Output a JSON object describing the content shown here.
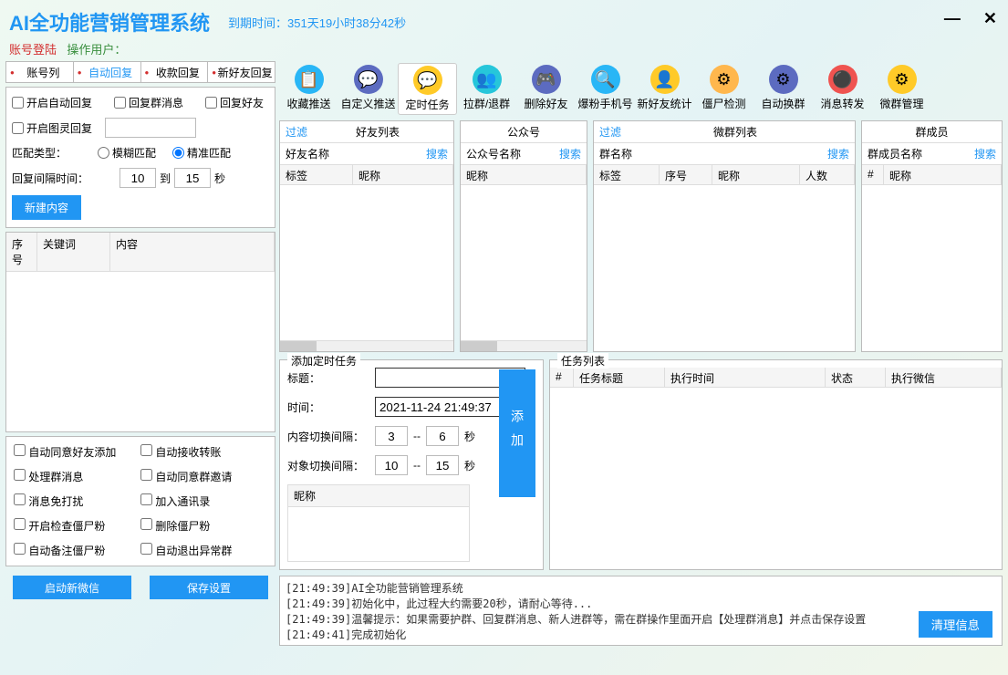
{
  "header": {
    "title": "AI全功能营销管理系统",
    "expiry_label": "到期时间：",
    "expiry_value": "351天19小时38分42秒"
  },
  "subheader": {
    "login_label": "账号登陆",
    "user_label": "操作用户："
  },
  "tabs": [
    "账号列",
    "自动回复",
    "收款回复",
    "新好友回复"
  ],
  "active_tab": 1,
  "reply": {
    "auto_reply": "开启自动回复",
    "reply_group": "回复群消息",
    "reply_friend": "回复好友",
    "pic_reply": "开启图灵回复",
    "match_type": "匹配类型：",
    "fuzzy": "模糊匹配",
    "exact": "精准匹配",
    "interval_label": "回复间隔时间：",
    "from": "10",
    "to_word": "到",
    "to": "15",
    "second": "秒",
    "new_content": "新建内容"
  },
  "reply_table": {
    "cols": [
      "序号",
      "关键词",
      "内容"
    ]
  },
  "options": {
    "auto_accept": "自动同意好友添加",
    "auto_transfer": "自动接收转账",
    "process_group": "处理群消息",
    "auto_group_invite": "自动同意群邀请",
    "no_disturb": "消息免打扰",
    "add_contacts": "加入通讯录",
    "check_zombie": "开启检查僵尸粉",
    "del_zombie": "删除僵尸粉",
    "auto_note_zombie": "自动备注僵尸粉",
    "auto_exit_group": "自动退出异常群"
  },
  "bottom_buttons": {
    "start": "启动新微信",
    "save": "保存设置"
  },
  "toolbar": [
    {
      "label": "收藏推送",
      "icon": "📋",
      "bg": "#29b6f6"
    },
    {
      "label": "自定义推送",
      "icon": "💬",
      "bg": "#5c6bc0"
    },
    {
      "label": "定时任务",
      "icon": "💬",
      "bg": "#ffca28",
      "active": true
    },
    {
      "label": "拉群/退群",
      "icon": "👥",
      "bg": "#26c6da"
    },
    {
      "label": "删除好友",
      "icon": "🎮",
      "bg": "#5c6bc0"
    },
    {
      "label": "爆粉手机号",
      "icon": "🔍",
      "bg": "#29b6f6"
    },
    {
      "label": "新好友统计",
      "icon": "👤",
      "bg": "#ffca28"
    },
    {
      "label": "僵尸检测",
      "icon": "⚙",
      "bg": "#ffb74d"
    },
    {
      "label": "自动换群",
      "icon": "⚙",
      "bg": "#5c6bc0"
    },
    {
      "label": "消息转发",
      "icon": "⚫",
      "bg": "#ef5350"
    },
    {
      "label": "微群管理",
      "icon": "⚙",
      "bg": "#ffca28"
    }
  ],
  "friend_panel": {
    "filter": "过滤",
    "title": "好友列表",
    "search_label": "好友名称",
    "search": "搜索",
    "cols": [
      "标签",
      "昵称"
    ]
  },
  "public_panel": {
    "title": "公众号",
    "search_label": "公众号名称",
    "search": "搜索",
    "cols": [
      "昵称"
    ]
  },
  "group_panel": {
    "filter": "过滤",
    "title": "微群列表",
    "search_label": "群名称",
    "search": "搜索",
    "cols": [
      "标签",
      "序号",
      "昵称",
      "人数"
    ]
  },
  "member_panel": {
    "title": "群成员",
    "search_label": "群成员名称",
    "search": "搜索",
    "cols": [
      "#",
      "昵称"
    ]
  },
  "add_task": {
    "title": "添加定时任务",
    "topic": "标题：",
    "time": "时间：",
    "time_value": "2021-11-24 21:49:37",
    "content_interval": "内容切换间隔：",
    "content_from": "3",
    "content_to": "6",
    "target_interval": "对象切换间隔：",
    "target_from": "10",
    "target_to": "15",
    "dash": "--",
    "second": "秒",
    "nick": "昵称",
    "add": "添加"
  },
  "task_list": {
    "title": "任务列表",
    "cols": [
      "#",
      "任务标题",
      "执行时间",
      "状态",
      "执行微信"
    ]
  },
  "log": {
    "lines": [
      "[21:49:39]AI全功能营销管理系统",
      "[21:49:39]初始化中，此过程大约需要20秒，请耐心等待...",
      "[21:49:39]温馨提示：如果需要护群、回复群消息、新人进群等，需在群操作里面开启【处理群消息】并点击保存设置",
      "[21:49:41]完成初始化"
    ],
    "clear": "清理信息"
  }
}
